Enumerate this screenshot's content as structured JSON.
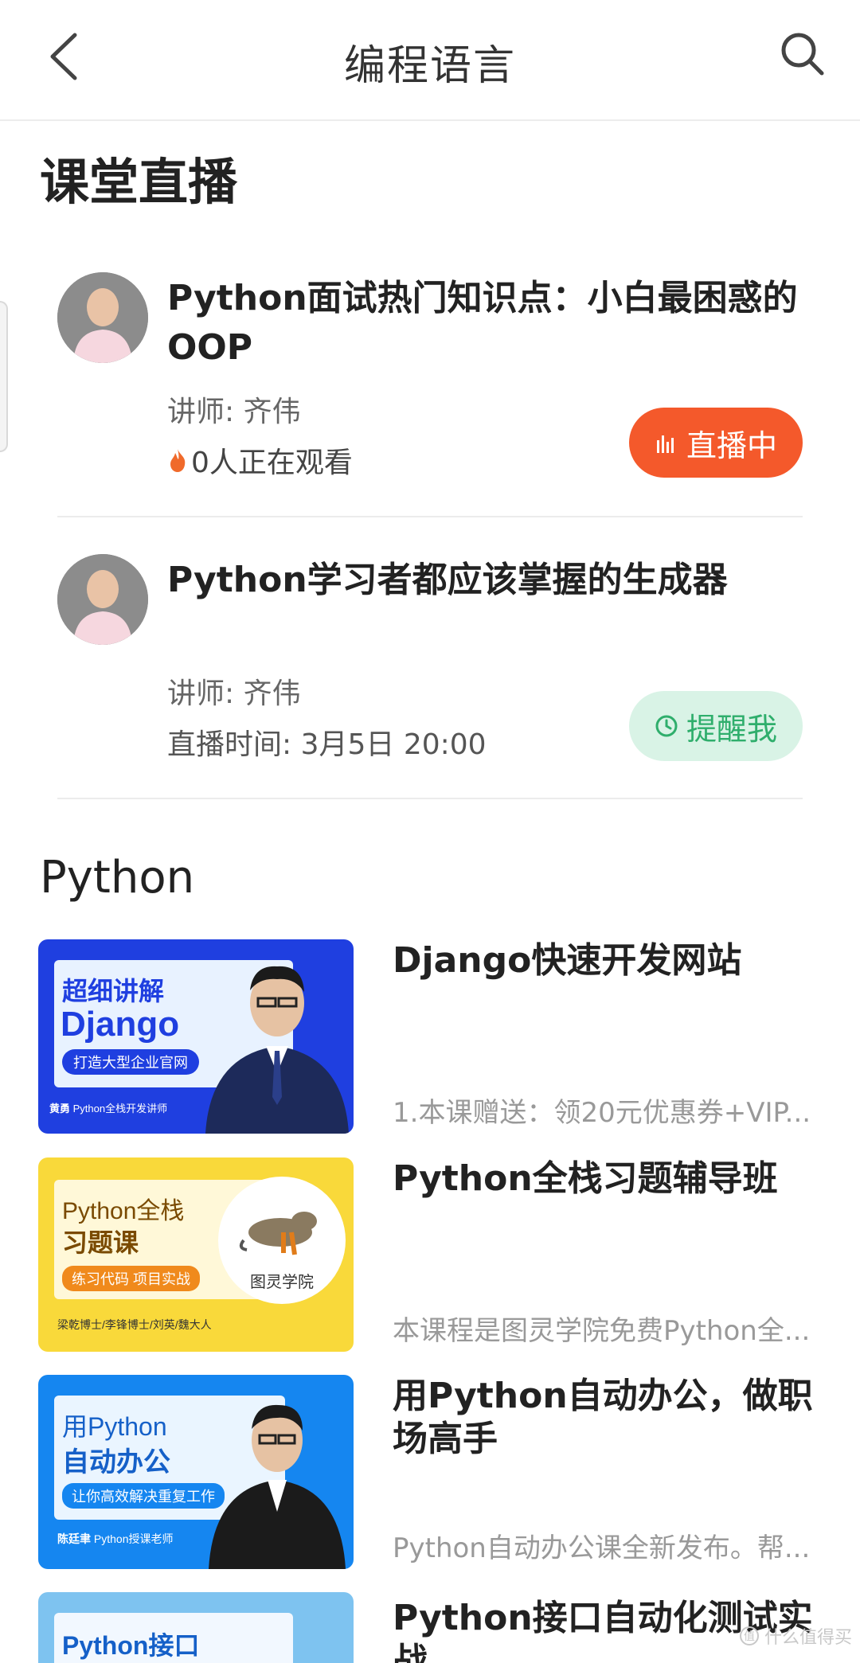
{
  "header": {
    "title": "编程语言",
    "back_icon": "chevron-left-icon",
    "search_icon": "search-icon"
  },
  "live_section": {
    "heading": "课堂直播",
    "items": [
      {
        "title": "Python面试热门知识点：小白最困惑的OOP",
        "teacher": "讲师: 齐伟",
        "status_text": "0人正在观看",
        "button_label": "直播中",
        "button_color": "#f4592b"
      },
      {
        "title": "Python学习者都应该掌握的生成器",
        "teacher": "讲师: 齐伟",
        "status_text": "直播时间: 3月5日 20:00",
        "button_label": "提醒我",
        "button_color": "#2fae6c"
      }
    ]
  },
  "python_section": {
    "heading": "Python",
    "courses": [
      {
        "title": "Django快速开发网站",
        "desc": "1.本课赠送：领20元优惠券+VIP...",
        "thumb": {
          "line1": "超细讲解",
          "line2": "Django",
          "tag": "打造大型企业官网",
          "footer_name": "黄勇",
          "footer_role": "Python全栈开发讲师",
          "bg": "#1f3fe0"
        }
      },
      {
        "title": "Python全栈习题辅导班",
        "desc": "本课程是图灵学院免费Python全...",
        "thumb": {
          "line1": "Python全栈",
          "line2": "习题课",
          "tag": "练习代码 项目实战",
          "badge": "图灵学院",
          "footer_name": "梁乾博士/李锋博士/刘英/魏大人",
          "bg": "#f9d93a"
        }
      },
      {
        "title": "用Python自动办公，做职场高手",
        "desc": "Python自动办公课全新发布。帮...",
        "thumb": {
          "line1": "用Python",
          "line2": "自动办公",
          "tag": "让你高效解决重复工作",
          "footer_name": "陈廷聿",
          "footer_role": "Python授课老师",
          "bg": "#1586f0"
        }
      },
      {
        "title": "Python接口自动化测试实战",
        "desc": "",
        "thumb": {
          "line1": "Python接口",
          "bg": "#7ec3f0"
        }
      }
    ]
  },
  "watermark": "什么值得买"
}
